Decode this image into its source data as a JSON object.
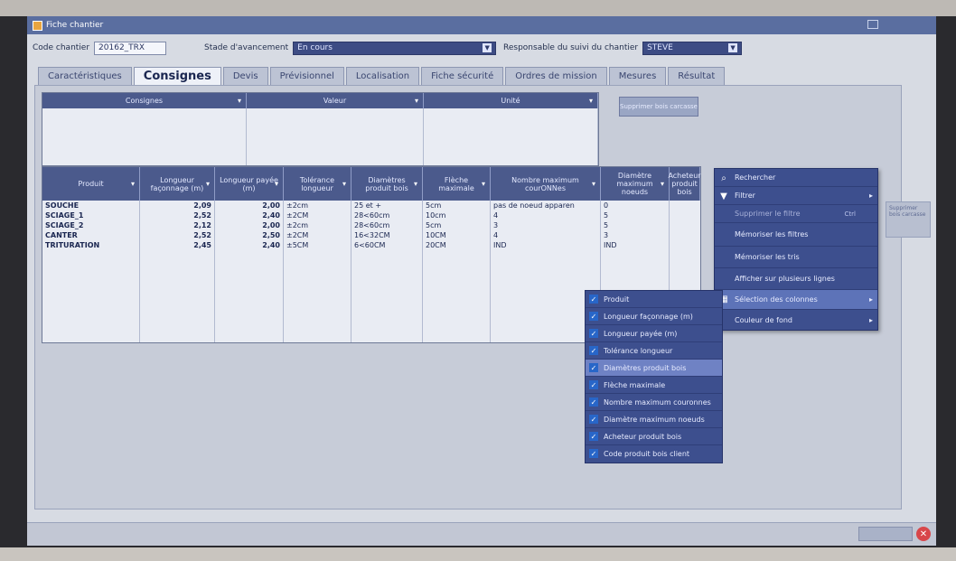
{
  "window": {
    "title": "Fiche chantier"
  },
  "header": {
    "code_label": "Code chantier",
    "code_value": "20162_TRX",
    "stade_label": "Stade d'avancement",
    "stade_value": "En cours",
    "responsable_label": "Responsable du suivi du chantier",
    "responsable_value": "STEVE"
  },
  "tabs": [
    {
      "label": "Caractéristiques"
    },
    {
      "label": "Consignes"
    },
    {
      "label": "Devis"
    },
    {
      "label": "Prévisionnel"
    },
    {
      "label": "Localisation"
    },
    {
      "label": "Fiche sécurité"
    },
    {
      "label": "Ordres de mission"
    },
    {
      "label": "Mesures"
    },
    {
      "label": "Résultat"
    }
  ],
  "consignes_grid": {
    "headers": [
      "Consignes",
      "Valeur",
      "Unité"
    ],
    "suppress_button": "Supprimer bois carcasse"
  },
  "produits_grid": {
    "headers": [
      "Produit",
      "Longueur façonnage (m)",
      "Longueur payée (m)",
      "Tolérance longueur",
      "Diamètres produit bois",
      "Flèche maximale",
      "Nombre maximum courONNes",
      "Diamètre maximum noeuds",
      "Acheteur produit bois"
    ],
    "rows": [
      {
        "produit": "SOUCHE",
        "long_fac": "2,09",
        "long_pay": "2,00",
        "tol": "±2cm",
        "diam": "25 et +",
        "fleche": "5cm",
        "nombre": "pas de noeud apparen",
        "diam_noeuds": "0"
      },
      {
        "produit": "SCIAGE_1",
        "long_fac": "2,52",
        "long_pay": "2,40",
        "tol": "±2CM",
        "diam": "28<60cm",
        "fleche": "10cm",
        "nombre": "4",
        "diam_noeuds": "5"
      },
      {
        "produit": "SCIAGE_2",
        "long_fac": "2,12",
        "long_pay": "2,00",
        "tol": "±2cm",
        "diam": "28<60cm",
        "fleche": "5cm",
        "nombre": "3",
        "diam_noeuds": "5"
      },
      {
        "produit": "CANTER",
        "long_fac": "2,52",
        "long_pay": "2,50",
        "tol": "±2CM",
        "diam": "16<32CM",
        "fleche": "10CM",
        "nombre": "4",
        "diam_noeuds": "3"
      },
      {
        "produit": "TRITURATION",
        "long_fac": "2,45",
        "long_pay": "2,40",
        "tol": "±5CM",
        "diam": "6<60CM",
        "fleche": "20CM",
        "nombre": "IND",
        "diam_noeuds": "IND"
      }
    ]
  },
  "context_menu": {
    "items": [
      {
        "label": "Rechercher",
        "icon": "search-icon"
      },
      {
        "label": "Filtrer",
        "icon": "filter-icon"
      },
      {
        "label": "Supprimer le filtre",
        "shortcut": "Ctrl"
      },
      {
        "label": "Mémoriser les filtres"
      },
      {
        "label": "Mémoriser les tris"
      },
      {
        "label": "Afficher sur plusieurs lignes"
      },
      {
        "label": "Sélection des colonnes"
      },
      {
        "label": "Couleur de fond"
      }
    ]
  },
  "columns_menu": {
    "items": [
      {
        "label": "Produit"
      },
      {
        "label": "Longueur façonnage (m)"
      },
      {
        "label": "Longueur payée (m)"
      },
      {
        "label": "Tolérance longueur"
      },
      {
        "label": "Diamètres produit bois"
      },
      {
        "label": "Flèche maximale"
      },
      {
        "label": "Nombre maximum couronnes"
      },
      {
        "label": "Diamètre maximum noeuds"
      },
      {
        "label": "Acheteur produit bois"
      },
      {
        "label": "Code produit bois client"
      }
    ]
  },
  "side_stub_text": "Supprimer bois carcasse"
}
